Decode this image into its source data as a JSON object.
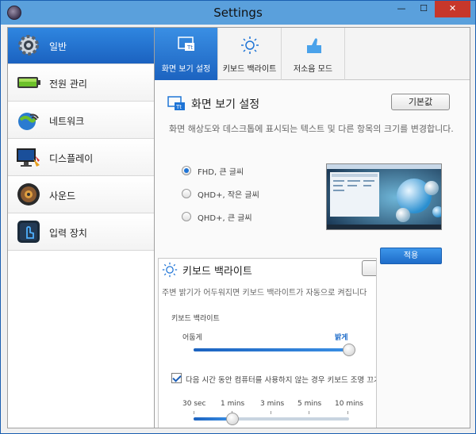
{
  "window": {
    "title": "Settings",
    "minimize": "—",
    "maximize": "☐",
    "close": "✕"
  },
  "sidebar": {
    "items": [
      {
        "label": "일반",
        "icon": "gear-icon",
        "active": true
      },
      {
        "label": "전원 관리",
        "icon": "battery-icon",
        "active": false
      },
      {
        "label": "네트워크",
        "icon": "wifi-globe-icon",
        "active": false
      },
      {
        "label": "디스플레이",
        "icon": "monitor-icon",
        "active": false
      },
      {
        "label": "사운드",
        "icon": "speaker-icon",
        "active": false
      },
      {
        "label": "입력 장치",
        "icon": "touch-input-icon",
        "active": false
      }
    ]
  },
  "tabs": [
    {
      "label": "화면 보기 설정",
      "icon": "display-text-icon",
      "active": true
    },
    {
      "label": "키보드 백라이트",
      "icon": "keyboard-light-icon",
      "active": false
    },
    {
      "label": "저소음 모드",
      "icon": "quiet-mode-icon",
      "active": false
    }
  ],
  "display": {
    "title": "화면 보기 설정",
    "default_button": "기본값",
    "description": "화면 해상도와 데스크톱에 표시되는 텍스트 및 다른 항목의 크기를 변경합니다.",
    "options": [
      {
        "label": "FHD, 큰 글씨",
        "checked": true
      },
      {
        "label": "QHD+, 작은 글씨",
        "checked": false
      },
      {
        "label": "QHD+, 큰 글씨",
        "checked": false
      }
    ],
    "apply_button": "적용"
  },
  "keyboard": {
    "title": "키보드 백라이트",
    "description": "주변 밝기가 어두워지면 키보드 백라이트가 자동으로 켜집니다",
    "brightness_label": "키보드 백라이트",
    "dark_label": "어둡게",
    "bright_label": "밝게",
    "brightness_level": 1.0,
    "timeout_checkbox": "다음 시간 동안 컴퓨터를 사용하지 않는 경우 키보드 조명 끄기",
    "timeout_checked": true,
    "timeout_ticks": [
      "30 sec",
      "1 mins",
      "3 mins",
      "5 mins",
      "10 mins"
    ],
    "timeout_value": "1 mins"
  },
  "colors": {
    "accent": "#1e6cc9",
    "titlebar": "#5aa0dc",
    "close": "#c7372b"
  }
}
